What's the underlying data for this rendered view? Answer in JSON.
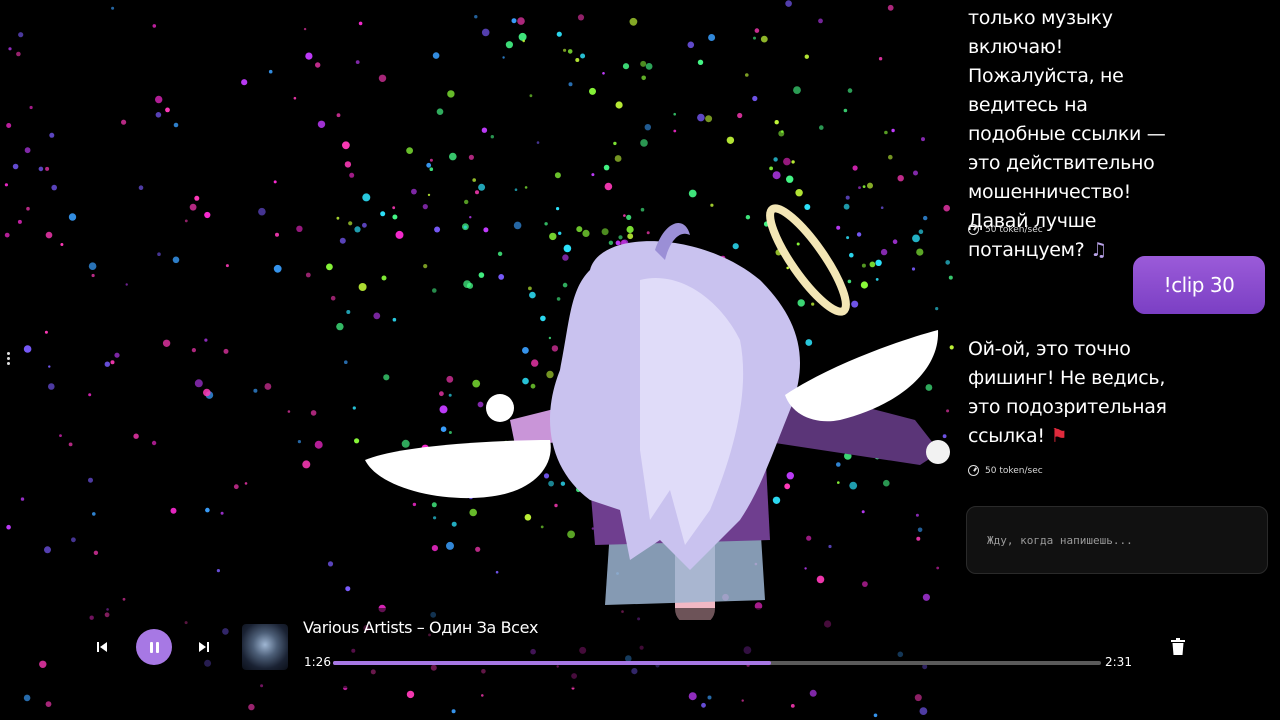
{
  "chat": {
    "messages": [
      {
        "role": "bot",
        "text": "только музыку включаю! Пожалуйста, не ведитесь на подобные ссылки — это действительно мошенничество! Давай лучше потанцуем?",
        "emoji": "♫",
        "meta": "50 token/sec"
      },
      {
        "role": "user",
        "text": "!clip 30"
      },
      {
        "role": "bot",
        "text": "Ой-ой, это точно фишинг! Не ведись, это подозрительная ссылка!",
        "emoji": "⚑",
        "meta": "50 token/sec"
      }
    ],
    "input_placeholder": "Жду, когда напишешь..."
  },
  "player": {
    "track_title": "Various Artists – Один За Всех",
    "time_current": "1:26",
    "time_total": "2:31",
    "progress": 0.57,
    "state": "playing",
    "icons": {
      "prev": "skip-previous-icon",
      "play": "pause-icon",
      "next": "skip-next-icon",
      "delete": "trash-icon"
    }
  },
  "colors": {
    "accent": "#a778e4",
    "user_bubble": "#8b4fd0",
    "background": "#000000"
  }
}
